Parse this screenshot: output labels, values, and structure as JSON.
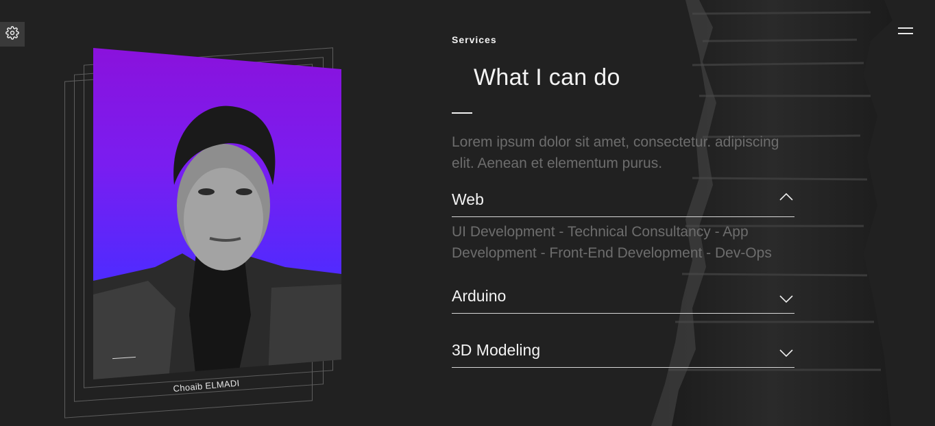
{
  "header": {
    "settings_icon": "gear-icon",
    "menu_icon": "hamburger-icon"
  },
  "portrait": {
    "caption": "Choaib ELMADI",
    "gradient_colors": [
      "#8a12dc",
      "#4f2bff"
    ]
  },
  "services": {
    "eyebrow": "Services",
    "title": "What I can do",
    "intro": "Lorem ipsum dolor sit amet, consectetur. adipiscing elit. Aenean et elementum purus.",
    "items": [
      {
        "label": "Web",
        "expanded": true,
        "icon": "chevron-up-icon",
        "body": "UI Development - Technical Consultancy - App Development - Front-End Development - Dev-Ops"
      },
      {
        "label": "Arduino",
        "expanded": false,
        "icon": "chevron-down-icon"
      },
      {
        "label": "3D Modeling",
        "expanded": false,
        "icon": "chevron-down-icon"
      }
    ]
  },
  "colors": {
    "background": "#212121",
    "muted_text": "#6d6d6d",
    "rule": "#d9d9d9"
  }
}
